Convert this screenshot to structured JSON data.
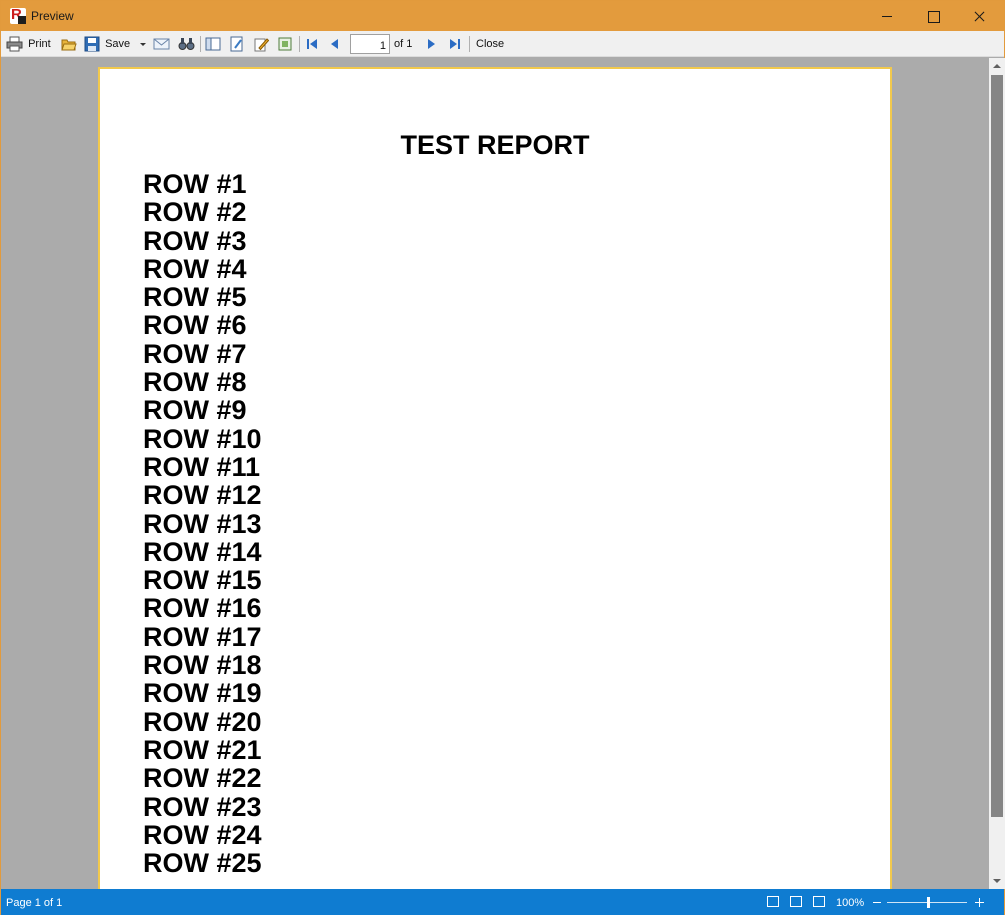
{
  "window": {
    "title": "Preview",
    "app_icon_letter": "R"
  },
  "toolbar": {
    "print_label": "Print",
    "save_label": "Save",
    "page_value": "1",
    "page_of": "of 1",
    "close_label": "Close"
  },
  "report": {
    "title": "TEST REPORT",
    "rows": [
      "ROW #1",
      "ROW #2",
      "ROW #3",
      "ROW #4",
      "ROW #5",
      "ROW #6",
      "ROW #7",
      "ROW #8",
      "ROW #9",
      "ROW #10",
      "ROW #11",
      "ROW #12",
      "ROW #13",
      "ROW #14",
      "ROW #15",
      "ROW #16",
      "ROW #17",
      "ROW #18",
      "ROW #19",
      "ROW #20",
      "ROW #21",
      "ROW #22",
      "ROW #23",
      "ROW #24",
      "ROW #25"
    ]
  },
  "statusbar": {
    "page_info": "Page 1 of 1",
    "zoom": "100%"
  },
  "colors": {
    "titlebar": "#e39b3d",
    "statusbar": "#0f7cd1",
    "page_border": "#f2c94c"
  }
}
